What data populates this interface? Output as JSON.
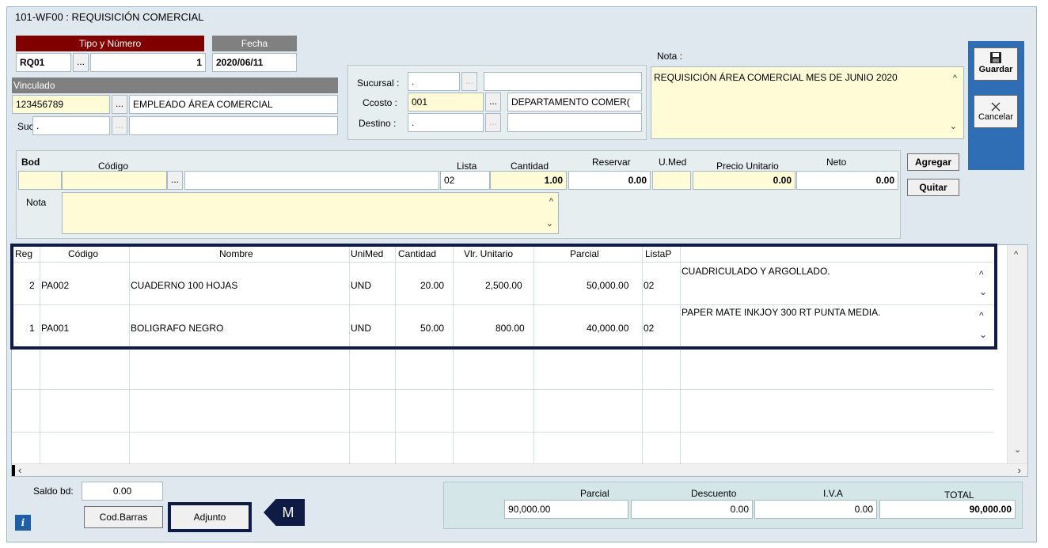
{
  "window": {
    "title": "101-WF00 : REQUISICIÓN COMERCIAL"
  },
  "header": {
    "tipo_label": "Tipo y Número",
    "fecha_label": "Fecha",
    "tipo_value": "RQ01",
    "numero_value": "1",
    "fecha_value": "2020/06/11",
    "vinculado_label": "Vinculado",
    "vinculado_id": "123456789",
    "vinculado_name": "EMPLEADO ÁREA COMERCIAL",
    "suc_label": "Suc.",
    "suc_value": "."
  },
  "location": {
    "sucursal_label": "Sucursal :",
    "sucursal_value": ".",
    "sucursal_name": "",
    "ccosto_label": "Ccosto :",
    "ccosto_value": "001",
    "ccosto_name": "DEPARTAMENTO COMER(",
    "destino_label": "Destino :",
    "destino_value": ".",
    "destino_name": ""
  },
  "nota": {
    "label": "Nota :",
    "value": "REQUISICIÓN ÁREA COMERCIAL MES DE JUNIO 2020"
  },
  "actions": {
    "guardar": "Guardar",
    "cancelar": "Cancelar"
  },
  "item_entry": {
    "bod_label": "Bod",
    "codigo_label": "Código",
    "lista_label": "Lista",
    "cantidad_label": "Cantidad",
    "reservar_label": "Reservar",
    "umed_label": "U.Med",
    "precio_label": "Precio Unitario",
    "neto_label": "Neto",
    "lista_value": "02",
    "cantidad_value": "1.00",
    "reservar_value": "0.00",
    "precio_value": "0.00",
    "neto_value": "0.00",
    "nota_label": "Nota",
    "agregar": "Agregar",
    "quitar": "Quitar"
  },
  "grid": {
    "columns": [
      "Reg",
      "Código",
      "Nombre",
      "UniMed",
      "Cantidad",
      "Vlr. Unitario",
      "Parcial",
      "ListaP"
    ],
    "rows": [
      {
        "reg": "2",
        "codigo": "PA002",
        "nombre": "CUADERNO 100 HOJAS",
        "unimed": "UND",
        "cantidad": "20.00",
        "vlr": "2,500.00",
        "parcial": "50,000.00",
        "listap": "02",
        "nota": "CUADRICULADO Y ARGOLLADO."
      },
      {
        "reg": "1",
        "codigo": "PA001",
        "nombre": "BOLIGRAFO NEGRO",
        "unimed": "UND",
        "cantidad": "50.00",
        "vlr": "800.00",
        "parcial": "40,000.00",
        "listap": "02",
        "nota": "PAPER MATE INKJOY 300 RT PUNTA MEDIA."
      }
    ]
  },
  "footer": {
    "saldo_label": "Saldo bd:",
    "saldo_value": "0.00",
    "codbarras": "Cod.Barras",
    "adjunto": "Adjunto",
    "marker": "M",
    "info_icon": "i"
  },
  "totals": {
    "parcial_label": "Parcial",
    "descuento_label": "Descuento",
    "iva_label": "I.V.A",
    "total_label": "TOTAL",
    "parcial_value": "90,000.00",
    "descuento_value": "0.00",
    "iva_value": "0.00",
    "total_value": "90,000.00"
  },
  "colors": {
    "header_red": "#800000",
    "header_gray": "#808080",
    "input_yellow": "#fffbd6",
    "sidebar_blue": "#2f6db5",
    "highlight_navy": "#0f1a45"
  }
}
